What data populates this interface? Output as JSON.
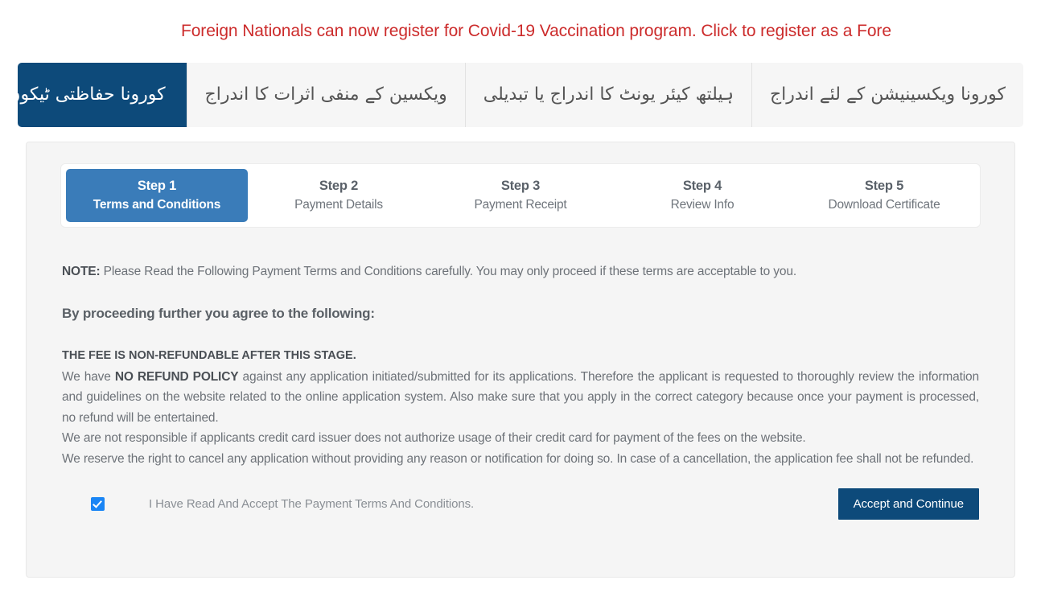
{
  "announcement": {
    "text": "Foreign Nationals can now register for Covid-19 Vaccination program. Click to register as a Fore",
    "color": "#cc2b2b"
  },
  "nav": {
    "items": [
      {
        "label": "کورونا ویکسینیشن کے لئے اندراج",
        "active": false
      },
      {
        "label": "ہیلتھ کیئر یونٹ کا اندراج یا تبدیلی",
        "active": false
      },
      {
        "label": "ویکسین کے منفی اثرات کا اندراج",
        "active": false
      },
      {
        "label": "کورونا حفاظتی ٹیکوں کا سر ٹیفکیٹ",
        "active": true
      }
    ],
    "active_color": "#0d4a7a"
  },
  "stepper": {
    "active_color": "#3a7cb9",
    "steps": [
      {
        "title": "Step 1",
        "subtitle": "Terms and Conditions",
        "active": true
      },
      {
        "title": "Step 2",
        "subtitle": "Payment Details",
        "active": false
      },
      {
        "title": "Step 3",
        "subtitle": "Payment Receipt",
        "active": false
      },
      {
        "title": "Step 4",
        "subtitle": "Review Info",
        "active": false
      },
      {
        "title": "Step 5",
        "subtitle": "Download Certificate",
        "active": false
      }
    ]
  },
  "content": {
    "note_label": "NOTE:",
    "note_text": " Please Read the Following Payment Terms and Conditions carefully. You may only proceed if these terms are acceptable to you.",
    "agree_heading": "By proceeding further you agree to the following:",
    "fee_notice": "THE FEE IS NON-REFUNDABLE AFTER THIS STAGE.",
    "para1_a": "We have ",
    "para1_bold": "NO REFUND POLICY",
    "para1_b": " against any application initiated/submitted for its applications. Therefore the applicant is requested to thoroughly review the information and guidelines on the website related to the online application system. Also make sure that you apply in the correct category because once your payment is processed, no refund will be entertained.",
    "para2": "We are not responsible if applicants credit card issuer does not authorize usage of their credit card for payment of the fees on the website.",
    "para3": "We reserve the right to cancel any application without providing any reason or notification for doing so. In case of a cancellation, the application fee shall not be refunded."
  },
  "footer": {
    "checkbox_checked": true,
    "checkbox_label": "I Have Read And Accept The Payment Terms And Conditions.",
    "accept_button": "Accept and Continue",
    "accept_button_color": "#0d4a7a",
    "checkbox_color": "#1a85f5"
  }
}
